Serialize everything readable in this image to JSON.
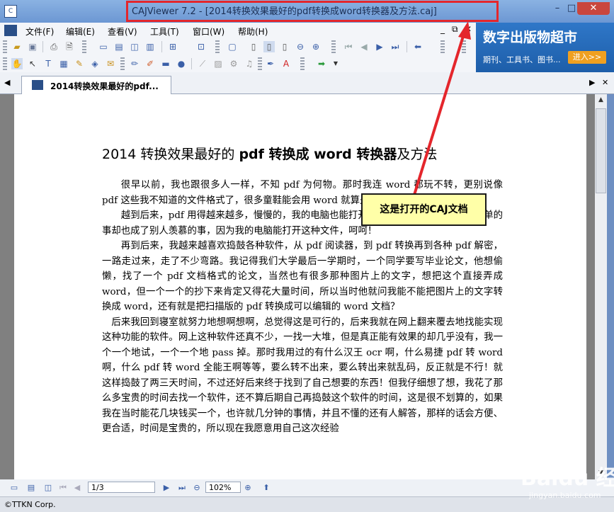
{
  "window": {
    "app_icon": "caj-icon",
    "title": "CAJViewer 7.2 - [2014转换效果最好的pdf转换成word转换器及方法.caj]",
    "min": "–",
    "max": "□",
    "close": "✕"
  },
  "menu": {
    "items": [
      "文件(F)",
      "编辑(E)",
      "查看(V)",
      "工具(T)",
      "窗口(W)",
      "帮助(H)"
    ],
    "mdi_min": "_",
    "mdi_restore": "⧉",
    "mdi_close": "✕"
  },
  "ad": {
    "title": "数字出版物超市",
    "subtitle": "期刊、工具书、图书...",
    "enter": "进入>>"
  },
  "tab": {
    "label": "2014转换效果最好的pdf...",
    "left": "◀",
    "right": "▶",
    "close": "✕"
  },
  "document": {
    "title_parts": [
      "2014 转换效果最好的 ",
      "pdf 转换成 word 转换器",
      "及方法"
    ],
    "paragraphs": [
      "很早以前，我也跟很多人一样，不知 pdf 为何物。那时我连 word 都玩不转，更别说像 pdf 这些我不知道的文件格式了，很多童鞋能会用 word 就算是谢天谢地了。",
      "越到后来，pdf 用得越来越多，慢慢的，我的电脑也能打开 pdf 了。然而就这一件很简单的事却也成了别人羡慕的事，因为我的电脑能打开这种文件，呵呵！",
      "再到后来，我越来越喜欢捣鼓各种软件，从 pdf 阅读器，到 pdf 转换再到各种 pdf 解密，一路走过来，走了不少弯路。我记得我们大学最后一学期时，一个同学要写毕业论文，他想偷懒，找了一个 pdf 文档格式的论文，当然也有很多那种图片上的文字，想把这个直接弄成 word，但一个一个的抄下来肯定又得花大量时间，所以当时他就问我能不能把图片上的文字转换成 word，还有就是把扫描版的 pdf 转换成可以编辑的 word 文档？",
      "后来我回到寝室就努力地想啊想啊，总觉得这是可行的，后来我就在网上翻来覆去地找能实现这种功能的软件。网上这种软件还真不少，一找一大堆，但是真正能有效果的却几乎没有，我一个一个地试，一个一个地 pass 掉。那时我用过的有什么汉王 ocr 啊，什么易捷 pdf 转 word 啊，什么 pdf 转 word 全能王啊等等，要么转不出来，要么转出来就乱码，反正就是不行！就这样捣鼓了两三天时间，不过还好后来终于找到了自己想要的东西！但我仔细想了想，我花了那么多宝贵的时间去找一个软件，还不算后期自己再捣鼓这个软件的时间，这是很不划算的，如果我在当时能花几块钱买一个，也许就几分钟的事情，并且不懂的还有人解答，那样的话会方便、更合适，时间是宝贵的，所以现在我愿意用自己这次经验"
    ]
  },
  "annotation": {
    "callout": "这是打开的CAJ文档",
    "arrow_color": "#e4262c",
    "box_color": "#e4262c"
  },
  "statusbar": {
    "page": "1/3",
    "zoom": "102%"
  },
  "footer": "©TTKN Corp.",
  "watermark": {
    "text": "Baidu 经验",
    "url": "jingyan.baidu.com"
  }
}
